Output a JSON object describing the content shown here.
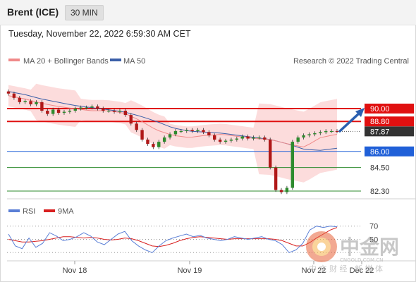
{
  "header": {
    "instrument": "Brent (ICE)",
    "timeframe": "30 MIN"
  },
  "timestamp": "Tuesday, November 22, 2022 6:59:30 AM CET",
  "legend": {
    "items": [
      {
        "label": "MA 20 + Bollinger Bands",
        "color": "#f08a8a"
      },
      {
        "label": "MA 50",
        "color": "#3b5fa8"
      }
    ],
    "credit": "Research © 2022 Trading Central"
  },
  "rsi_legend": {
    "items": [
      {
        "label": "RSI",
        "color": "#5a7fd6"
      },
      {
        "label": "9MA",
        "color": "#d82020"
      }
    ]
  },
  "levels": [
    {
      "value": 90.0,
      "label": "90.00",
      "kind": "resistance",
      "color": "#e01010",
      "badge": true,
      "badge_color": "#e01010",
      "line": true
    },
    {
      "value": 88.8,
      "label": "88.80",
      "kind": "resistance",
      "color": "#e01010",
      "badge": true,
      "badge_color": "#e01010",
      "line": true
    },
    {
      "value": 87.87,
      "label": "87.87",
      "kind": "last",
      "color": "#333333",
      "badge": true,
      "badge_color": "#333333",
      "line": false
    },
    {
      "value": 86.0,
      "label": "86.00",
      "kind": "pivot",
      "color": "#2060d8",
      "badge": true,
      "badge_color": "#2060d8",
      "line": true
    },
    {
      "value": 84.5,
      "label": "84.50",
      "kind": "support",
      "color": "#2e8b2e",
      "badge": false,
      "line": true
    },
    {
      "value": 82.3,
      "label": "82.30",
      "kind": "support",
      "color": "#2e8b2e",
      "badge": false,
      "line": true
    }
  ],
  "x_ticks": [
    "Nov 18",
    "Nov 19",
    "Nov 22",
    "Dec 22"
  ],
  "chart_data": [
    {
      "type": "line",
      "title": "Brent (ICE) 30 MIN",
      "series": [
        {
          "name": "Brent (ICE)",
          "kind": "candlestick-close",
          "values": [
            91.4,
            91.0,
            90.6,
            90.7,
            90.4,
            90.6,
            89.8,
            89.5,
            89.9,
            89.6,
            89.7,
            89.8,
            90.0,
            90.1,
            90.1,
            90.2,
            90.0,
            89.8,
            89.8,
            89.7,
            89.8,
            89.4,
            88.6,
            88.0,
            87.1,
            86.7,
            86.4,
            86.9,
            87.3,
            87.6,
            87.9,
            87.9,
            88.0,
            87.9,
            88.0,
            87.8,
            87.5,
            87.1,
            86.9,
            87.0,
            87.1,
            87.2,
            87.4,
            87.2,
            87.3,
            87.3,
            87.1,
            84.5,
            82.4,
            82.2,
            82.6,
            86.9,
            87.3,
            87.5,
            87.6,
            87.7,
            87.8,
            87.9,
            87.9,
            87.87
          ]
        },
        {
          "name": "MA 20",
          "values": [
            91.2,
            90.9,
            90.5,
            90.2,
            90.0,
            89.8,
            89.8,
            89.6,
            88.9,
            88.0,
            87.5,
            87.3,
            87.5,
            87.6,
            87.4,
            87.2,
            87.1,
            86.7,
            86.4,
            87.3,
            87.6
          ]
        },
        {
          "name": "MA 50",
          "values": [
            91.6,
            91.3,
            90.9,
            90.6,
            90.3,
            90.1,
            89.9,
            89.7,
            89.3,
            88.8,
            88.2,
            87.9,
            87.8,
            87.7,
            87.5,
            87.3,
            87.1,
            86.7,
            86.2,
            86.1,
            86.3
          ]
        }
      ],
      "xlabel": "",
      "ylabel": "",
      "x_ticks": [
        "Nov 18",
        "Nov 19",
        "Nov 22",
        "Dec 22"
      ],
      "ylim": [
        81.5,
        92.0
      ],
      "levels": [
        90.0,
        88.8,
        87.87,
        86.0,
        84.5,
        82.3
      ],
      "grid": false,
      "legend": "top-left"
    },
    {
      "type": "line",
      "title": "",
      "series": [
        {
          "name": "RSI",
          "values": [
            58,
            40,
            36,
            52,
            38,
            44,
            60,
            55,
            48,
            50,
            54,
            60,
            55,
            46,
            42,
            50,
            58,
            62,
            48,
            40,
            34,
            30,
            40,
            48,
            52,
            55,
            58,
            54,
            56,
            52,
            50,
            48,
            50,
            54,
            52,
            50,
            52,
            54,
            50,
            48,
            42,
            30,
            34,
            44,
            64,
            70,
            68,
            70,
            69
          ]
        },
        {
          "name": "9MA",
          "values": [
            50,
            48,
            46,
            46,
            47,
            48,
            50,
            52,
            54,
            54,
            53,
            52,
            53,
            52,
            50,
            49,
            50,
            52,
            51,
            48,
            44,
            40,
            39,
            41,
            44,
            48,
            51,
            53,
            54,
            53,
            52,
            51,
            50,
            51,
            51,
            51,
            51,
            51,
            51,
            50,
            48,
            44,
            40,
            40,
            45,
            52,
            58,
            64,
            68
          ]
        }
      ],
      "ylim": [
        25,
        75
      ],
      "reference_lines": [
        70,
        50,
        30
      ],
      "y_ticks": [
        "70",
        "50"
      ],
      "legend": "top-left"
    }
  ],
  "annotation": {
    "type": "arrow",
    "direction": "up-right",
    "color": "#2a5fb0"
  },
  "watermark": {
    "cn": "中金网",
    "domain": "CNGOLD.COM.CN",
    "tagline": "中 文 财 经 · 新 媒 体"
  }
}
